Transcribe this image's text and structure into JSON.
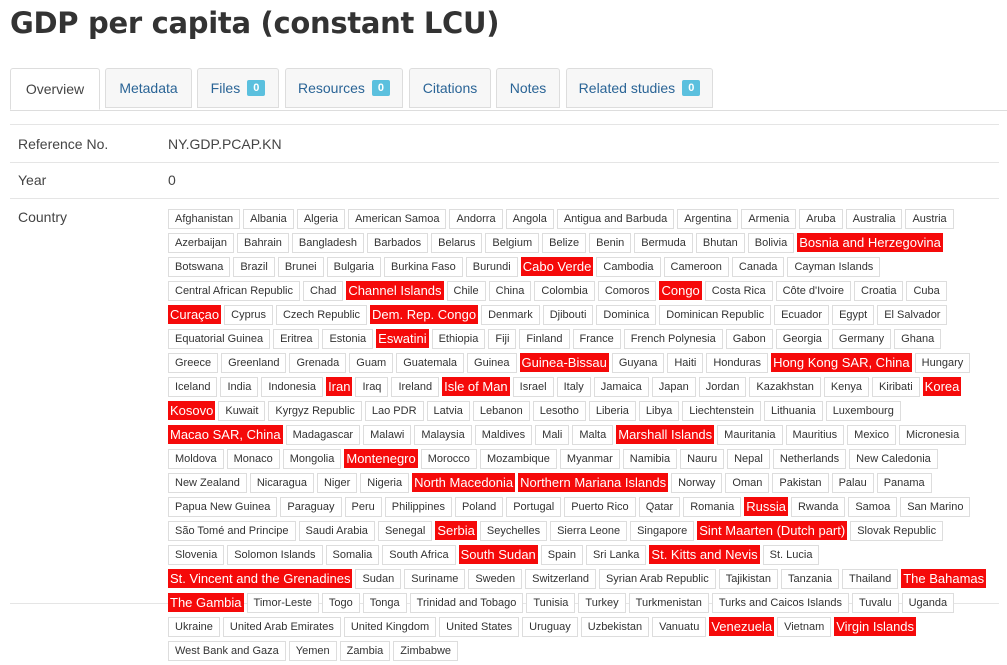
{
  "page_title": "GDP per capita (constant LCU)",
  "tabs": [
    {
      "label": "Overview",
      "badge": null,
      "active": true
    },
    {
      "label": "Metadata",
      "badge": null,
      "active": false
    },
    {
      "label": "Files",
      "badge": "0",
      "active": false
    },
    {
      "label": "Resources",
      "badge": "0",
      "active": false
    },
    {
      "label": "Citations",
      "badge": null,
      "active": false
    },
    {
      "label": "Notes",
      "badge": null,
      "active": false
    },
    {
      "label": "Related studies",
      "badge": "0",
      "active": false
    }
  ],
  "fields": {
    "reference_label": "Reference No.",
    "reference_value": "NY.GDP.PCAP.KN",
    "year_label": "Year",
    "year_value": "0",
    "country_label": "Country"
  },
  "highlight_color": "#f50a0a",
  "countries": [
    {
      "name": "Afghanistan"
    },
    {
      "name": "Albania"
    },
    {
      "name": "Algeria"
    },
    {
      "name": "American Samoa"
    },
    {
      "name": "Andorra"
    },
    {
      "name": "Angola"
    },
    {
      "name": "Antigua and Barbuda"
    },
    {
      "name": "Argentina"
    },
    {
      "name": "Armenia"
    },
    {
      "name": "Aruba"
    },
    {
      "name": "Australia"
    },
    {
      "name": "Austria"
    },
    {
      "name": "Azerbaijan"
    },
    {
      "name": "Bahrain"
    },
    {
      "name": "Bangladesh"
    },
    {
      "name": "Barbados"
    },
    {
      "name": "Belarus"
    },
    {
      "name": "Belgium"
    },
    {
      "name": "Belize"
    },
    {
      "name": "Benin"
    },
    {
      "name": "Bermuda"
    },
    {
      "name": "Bhutan"
    },
    {
      "name": "Bolivia"
    },
    {
      "name": "Bosnia and Herzegovina",
      "hl": true
    },
    {
      "name": "Botswana"
    },
    {
      "name": "Brazil"
    },
    {
      "name": "Brunei"
    },
    {
      "name": "Bulgaria"
    },
    {
      "name": "Burkina Faso"
    },
    {
      "name": "Burundi"
    },
    {
      "name": "Cabo Verde",
      "hl": true
    },
    {
      "name": "Cambodia"
    },
    {
      "name": "Cameroon"
    },
    {
      "name": "Canada"
    },
    {
      "name": "Cayman Islands"
    },
    {
      "name": "Central African Republic"
    },
    {
      "name": "Chad"
    },
    {
      "name": "Channel Islands",
      "hl": true
    },
    {
      "name": "Chile"
    },
    {
      "name": "China"
    },
    {
      "name": "Colombia"
    },
    {
      "name": "Comoros"
    },
    {
      "name": "Congo",
      "hl": true
    },
    {
      "name": "Costa Rica"
    },
    {
      "name": "Côte d'Ivoire"
    },
    {
      "name": "Croatia"
    },
    {
      "name": "Cuba"
    },
    {
      "name": "Curaçao",
      "hl": true
    },
    {
      "name": "Cyprus"
    },
    {
      "name": "Czech Republic"
    },
    {
      "name": "Dem. Rep. Congo",
      "hl": true
    },
    {
      "name": "Denmark"
    },
    {
      "name": "Djibouti"
    },
    {
      "name": "Dominica"
    },
    {
      "name": "Dominican Republic"
    },
    {
      "name": "Ecuador"
    },
    {
      "name": "Egypt"
    },
    {
      "name": "El Salvador"
    },
    {
      "name": "Equatorial Guinea"
    },
    {
      "name": "Eritrea"
    },
    {
      "name": "Estonia"
    },
    {
      "name": "Eswatini",
      "hl": true
    },
    {
      "name": "Ethiopia"
    },
    {
      "name": "Fiji"
    },
    {
      "name": "Finland"
    },
    {
      "name": "France"
    },
    {
      "name": "French Polynesia"
    },
    {
      "name": "Gabon"
    },
    {
      "name": "Georgia"
    },
    {
      "name": "Germany"
    },
    {
      "name": "Ghana"
    },
    {
      "name": "Greece"
    },
    {
      "name": "Greenland"
    },
    {
      "name": "Grenada"
    },
    {
      "name": "Guam"
    },
    {
      "name": "Guatemala"
    },
    {
      "name": "Guinea"
    },
    {
      "name": "Guinea-Bissau",
      "hl": true
    },
    {
      "name": "Guyana"
    },
    {
      "name": "Haiti"
    },
    {
      "name": "Honduras"
    },
    {
      "name": "Hong Kong SAR, China",
      "hl": true
    },
    {
      "name": "Hungary"
    },
    {
      "name": "Iceland"
    },
    {
      "name": "India"
    },
    {
      "name": "Indonesia"
    },
    {
      "name": "Iran",
      "hl": true
    },
    {
      "name": "Iraq"
    },
    {
      "name": "Ireland"
    },
    {
      "name": "Isle of Man",
      "hl": true
    },
    {
      "name": "Israel"
    },
    {
      "name": "Italy"
    },
    {
      "name": "Jamaica"
    },
    {
      "name": "Japan"
    },
    {
      "name": "Jordan"
    },
    {
      "name": "Kazakhstan"
    },
    {
      "name": "Kenya"
    },
    {
      "name": "Kiribati"
    },
    {
      "name": "Korea",
      "hl": true
    },
    {
      "name": "Kosovo",
      "hl": true
    },
    {
      "name": "Kuwait"
    },
    {
      "name": "Kyrgyz Republic"
    },
    {
      "name": "Lao PDR"
    },
    {
      "name": "Latvia"
    },
    {
      "name": "Lebanon"
    },
    {
      "name": "Lesotho"
    },
    {
      "name": "Liberia"
    },
    {
      "name": "Libya"
    },
    {
      "name": "Liechtenstein"
    },
    {
      "name": "Lithuania"
    },
    {
      "name": "Luxembourg"
    },
    {
      "name": "Macao SAR, China",
      "hl": true,
      "wrap": true
    },
    {
      "name": "Madagascar"
    },
    {
      "name": "Malawi"
    },
    {
      "name": "Malaysia"
    },
    {
      "name": "Maldives"
    },
    {
      "name": "Mali"
    },
    {
      "name": "Malta"
    },
    {
      "name": "Marshall Islands",
      "hl": true
    },
    {
      "name": "Mauritania"
    },
    {
      "name": "Mauritius"
    },
    {
      "name": "Mexico"
    },
    {
      "name": "Micronesia"
    },
    {
      "name": "Moldova"
    },
    {
      "name": "Monaco"
    },
    {
      "name": "Mongolia"
    },
    {
      "name": "Montenegro",
      "hl": true
    },
    {
      "name": "Morocco"
    },
    {
      "name": "Mozambique"
    },
    {
      "name": "Myanmar"
    },
    {
      "name": "Namibia"
    },
    {
      "name": "Nauru"
    },
    {
      "name": "Nepal"
    },
    {
      "name": "Netherlands"
    },
    {
      "name": "New Caledonia"
    },
    {
      "name": "New Zealand"
    },
    {
      "name": "Nicaragua"
    },
    {
      "name": "Niger"
    },
    {
      "name": "Nigeria"
    },
    {
      "name": "North Macedonia",
      "hl": true
    },
    {
      "name": "Northern Mariana Islands",
      "hl": true
    },
    {
      "name": "Norway"
    },
    {
      "name": "Oman"
    },
    {
      "name": "Pakistan"
    },
    {
      "name": "Palau"
    },
    {
      "name": "Panama"
    },
    {
      "name": "Papua New Guinea"
    },
    {
      "name": "Paraguay"
    },
    {
      "name": "Peru"
    },
    {
      "name": "Philippines"
    },
    {
      "name": "Poland"
    },
    {
      "name": "Portugal"
    },
    {
      "name": "Puerto Rico"
    },
    {
      "name": "Qatar"
    },
    {
      "name": "Romania"
    },
    {
      "name": "Russia",
      "hl": true
    },
    {
      "name": "Rwanda"
    },
    {
      "name": "Samoa"
    },
    {
      "name": "San Marino"
    },
    {
      "name": "São Tomé and Principe"
    },
    {
      "name": "Saudi Arabia"
    },
    {
      "name": "Senegal"
    },
    {
      "name": "Serbia",
      "hl": true
    },
    {
      "name": "Seychelles"
    },
    {
      "name": "Sierra Leone"
    },
    {
      "name": "Singapore"
    },
    {
      "name": "Sint Maarten (Dutch part)",
      "hl": true
    },
    {
      "name": "Slovak Republic"
    },
    {
      "name": "Slovenia"
    },
    {
      "name": "Solomon Islands"
    },
    {
      "name": "Somalia"
    },
    {
      "name": "South Africa"
    },
    {
      "name": "South Sudan",
      "hl": true
    },
    {
      "name": "Spain"
    },
    {
      "name": "Sri Lanka"
    },
    {
      "name": "St. Kitts and Nevis",
      "hl": true
    },
    {
      "name": "St. Lucia"
    },
    {
      "name": "St. Vincent and the Grenadines",
      "hl": true,
      "wrap": true
    },
    {
      "name": "Sudan"
    },
    {
      "name": "Suriname"
    },
    {
      "name": "Sweden"
    },
    {
      "name": "Switzerland"
    },
    {
      "name": "Syrian Arab Republic"
    },
    {
      "name": "Tajikistan"
    },
    {
      "name": "Tanzania"
    },
    {
      "name": "Thailand"
    },
    {
      "name": "The Bahamas",
      "hl": true
    },
    {
      "name": "The Gambia",
      "hl": true
    },
    {
      "name": "Timor-Leste"
    },
    {
      "name": "Togo"
    },
    {
      "name": "Tonga"
    },
    {
      "name": "Trinidad and Tobago"
    },
    {
      "name": "Tunisia"
    },
    {
      "name": "Turkey"
    },
    {
      "name": "Turkmenistan"
    },
    {
      "name": "Turks and Caicos Islands"
    },
    {
      "name": "Tuvalu"
    },
    {
      "name": "Uganda"
    },
    {
      "name": "Ukraine"
    },
    {
      "name": "United Arab Emirates"
    },
    {
      "name": "United Kingdom"
    },
    {
      "name": "United States"
    },
    {
      "name": "Uruguay"
    },
    {
      "name": "Uzbekistan"
    },
    {
      "name": "Vanuatu"
    },
    {
      "name": "Venezuela",
      "hl": true
    },
    {
      "name": "Vietnam"
    },
    {
      "name": "Virgin Islands",
      "hl": true
    },
    {
      "name": "West Bank and Gaza"
    },
    {
      "name": "Yemen"
    },
    {
      "name": "Zambia"
    },
    {
      "name": "Zimbabwe"
    }
  ]
}
